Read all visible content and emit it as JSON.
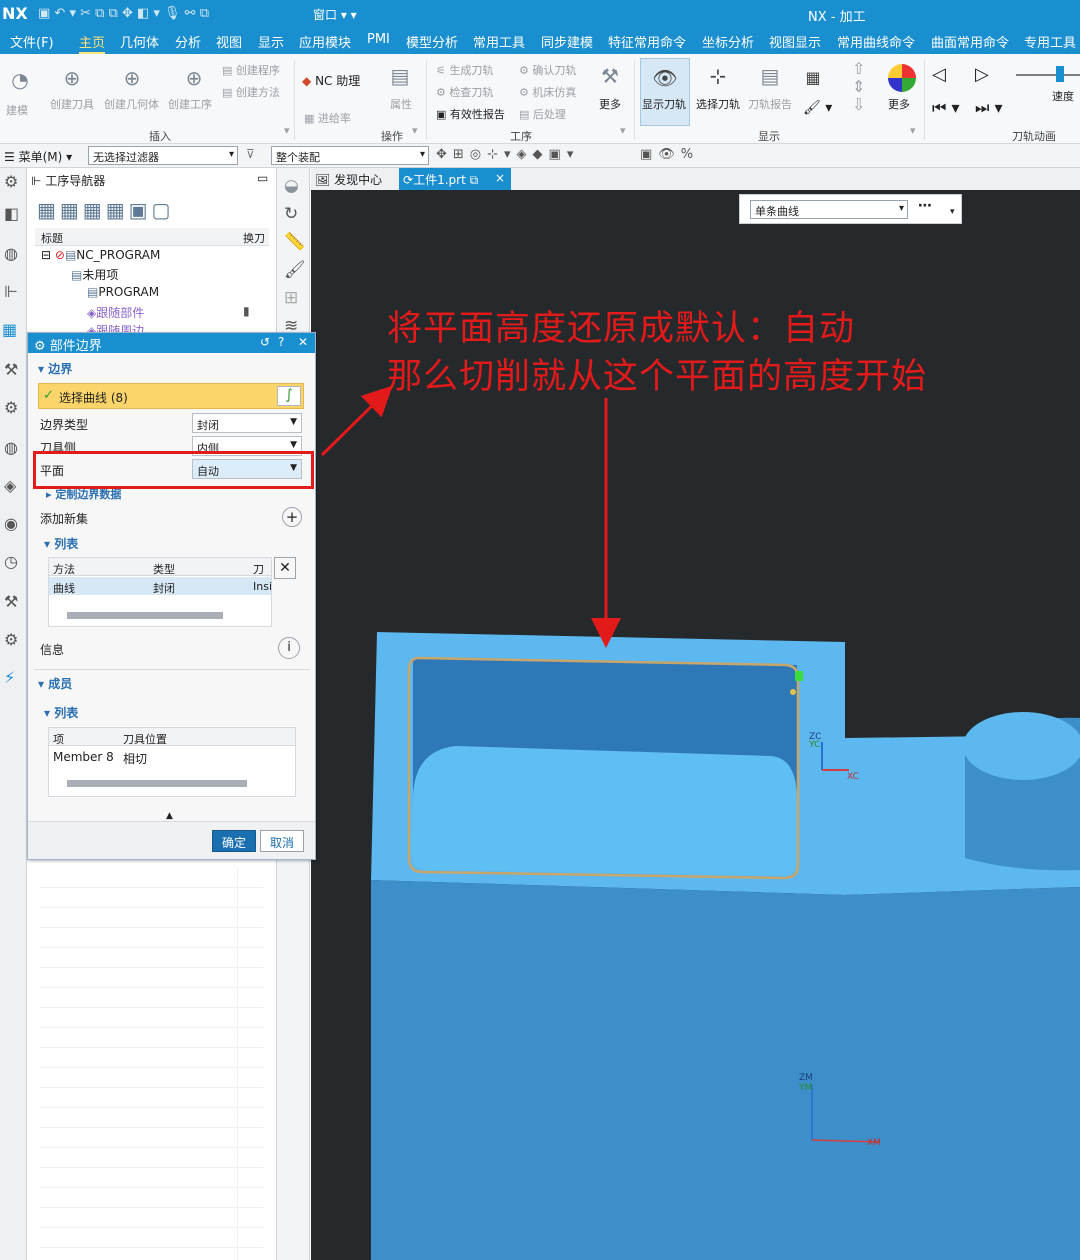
{
  "app": {
    "logo": "NX",
    "title": "NX - 加工",
    "window_menu": "窗口"
  },
  "menubar": {
    "items": [
      "文件(F)",
      "主页",
      "几何体",
      "分析",
      "视图",
      "显示",
      "应用模块",
      "PMI",
      "模型分析",
      "常用工具",
      "同步建模",
      "特征常用命令",
      "坐标分析",
      "视图显示",
      "常用曲线命令",
      "曲面常用命令",
      "专用工具"
    ],
    "active_index": 1
  },
  "ribbon": {
    "create_tool": "创建刀具",
    "create_geometry": "创建几何体",
    "create_operation": "创建工序",
    "create_program": "创建程序",
    "create_method": "创建方法",
    "nc_helper": "NC 助理",
    "feed_rate": "进给率",
    "properties": "属性",
    "generate_path": "生成刀轨",
    "check_path": "检查刀轨",
    "validity_report": "有效性报告",
    "confirm_path": "确认刀轨",
    "machine_sim": "机床仿真",
    "post_process": "后处理",
    "more": "更多",
    "show_path": "显示刀轨",
    "select_path": "选择刀轨",
    "path_report": "刀轨报告",
    "more2": "更多",
    "speed": "速度",
    "group_insert": "插入",
    "group_operate": "操作",
    "group_operation": "工序",
    "group_display": "显示",
    "group_animation": "刀轨动画",
    "sparkle": "建模"
  },
  "toolrow": {
    "menu": "菜单(M)",
    "filter": "无选择过滤器",
    "assembly": "整个装配"
  },
  "navigator": {
    "title": "工序导航器",
    "col_title": "标题",
    "col_change": "换刀",
    "items": [
      "NC_PROGRAM",
      "未用项",
      "PROGRAM",
      "跟随部件",
      "跟随周边"
    ]
  },
  "tabs": {
    "discover": "发现中心",
    "part": "工件1.prt"
  },
  "viewport": {
    "selection_mode": "单条曲线",
    "zc_label": "ZC",
    "yc_label": "YC",
    "xc_label": "XC",
    "zm_label": "ZM",
    "ym_label": "YM",
    "xm_label": "XM"
  },
  "dialog": {
    "title": "部件边界",
    "section_boundary": "边界",
    "select_curve": "选择曲线 (8)",
    "boundary_type_label": "边界类型",
    "boundary_type_value": "封闭",
    "tool_side_label": "刀具侧",
    "tool_side_value": "内侧",
    "plane_label": "平面",
    "plane_value": "自动",
    "custom_boundary": "定制边界数据",
    "add_new_set": "添加新集",
    "section_list": "列表",
    "list_headers": [
      "方法",
      "类型",
      "刀具"
    ],
    "list_row": [
      "曲线",
      "封闭",
      "Insi"
    ],
    "info": "信息",
    "section_members": "成员",
    "section_members_list": "列表",
    "members_headers": [
      "项",
      "刀具位置"
    ],
    "members_row": [
      "Member 8",
      "相切"
    ],
    "ok": "确定",
    "cancel": "取消"
  },
  "annotation": {
    "line1": "将平面高度还原成默认：自动",
    "line2": "那么切削就从这个平面的高度开始",
    "color": "#e21a1a"
  },
  "colors": {
    "accent": "#1a8fcf",
    "viewport_bg": "#26292c",
    "part_light": "#5cb8ee",
    "part_dark": "#3d8fc9"
  }
}
